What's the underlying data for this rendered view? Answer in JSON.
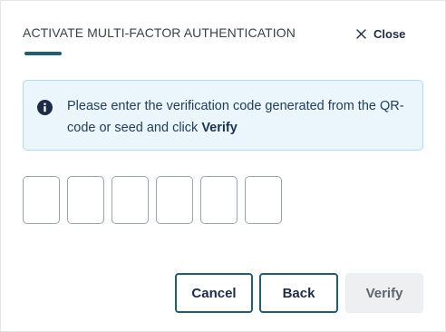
{
  "dialog": {
    "title": "ACTIVATE MULTI-FACTOR AUTHENTICATION",
    "close_label": "Close"
  },
  "info": {
    "icon": "info-icon",
    "text_before": "Please enter the verification code generated from the QR-code or seed and click ",
    "text_emphasis": "Verify"
  },
  "code": {
    "cells": [
      "",
      "",
      "",
      "",
      "",
      ""
    ]
  },
  "actions": {
    "cancel_label": "Cancel",
    "back_label": "Back",
    "verify_label": "Verify"
  },
  "colors": {
    "accent": "#1f5f72",
    "info_background": "#eaf6fc",
    "info_border": "#aedcf1",
    "disabled_button": "#eeeff0"
  }
}
